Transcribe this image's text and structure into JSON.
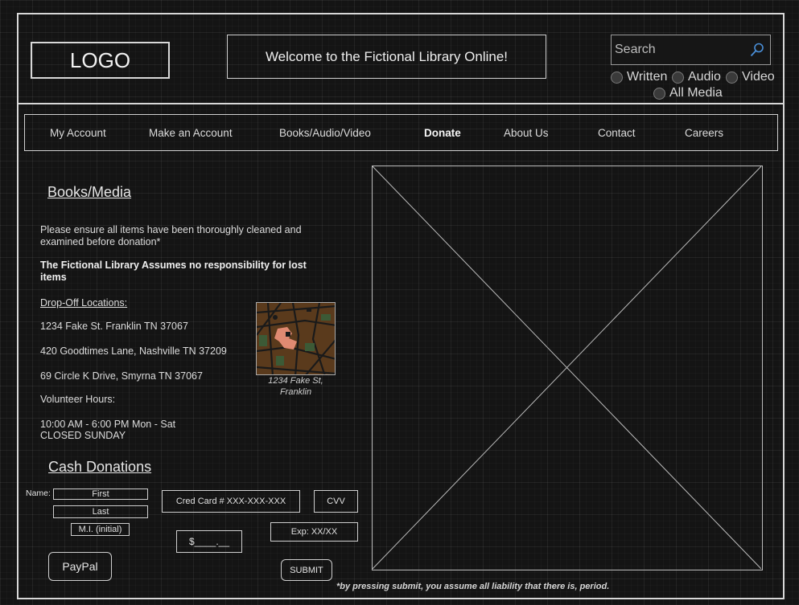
{
  "header": {
    "logo": "LOGO",
    "welcome": "Welcome to the Fictional Library Online!",
    "search_placeholder": "Search",
    "filters": [
      "Written",
      "Audio",
      "Video",
      "All Media"
    ]
  },
  "nav": {
    "items": [
      "My Account",
      "Make an Account",
      "Books/Audio/Video",
      "Donate",
      "About Us",
      "Contact",
      "Careers"
    ],
    "active": "Donate"
  },
  "books_media": {
    "title": "Books/Media",
    "notice": "Please ensure all items have been thoroughly cleaned and examined before donation*",
    "liability": "The Fictional Library Assumes no responsibility for lost items",
    "dropoff_heading": "Drop-Off Locations:",
    "locations": [
      "1234 Fake St. Franklin TN 37067",
      "420 Goodtimes Lane, Nashville TN 37209",
      "69 Circle K Drive, Smyrna TN 37067"
    ],
    "volunteer_heading": "Volunteer Hours:",
    "hours_line1": "10:00 AM - 6:00 PM Mon - Sat",
    "hours_line2": "CLOSED SUNDAY",
    "map_caption_line1": "1234 Fake St,",
    "map_caption_line2": "Franklin"
  },
  "cash": {
    "title": "Cash Donations",
    "name_label": "Name:",
    "first": "First",
    "last": "Last",
    "mi": "M.I. (initial)",
    "card": "Cred Card # XXX-XXX-XXX",
    "cvv": "CVV",
    "exp": "Exp: XX/XX",
    "amount": "$____.__",
    "paypal": "PayPal",
    "submit": "SUBMIT",
    "disclaimer": "*by pressing submit, you assume all liability that there is, period."
  }
}
